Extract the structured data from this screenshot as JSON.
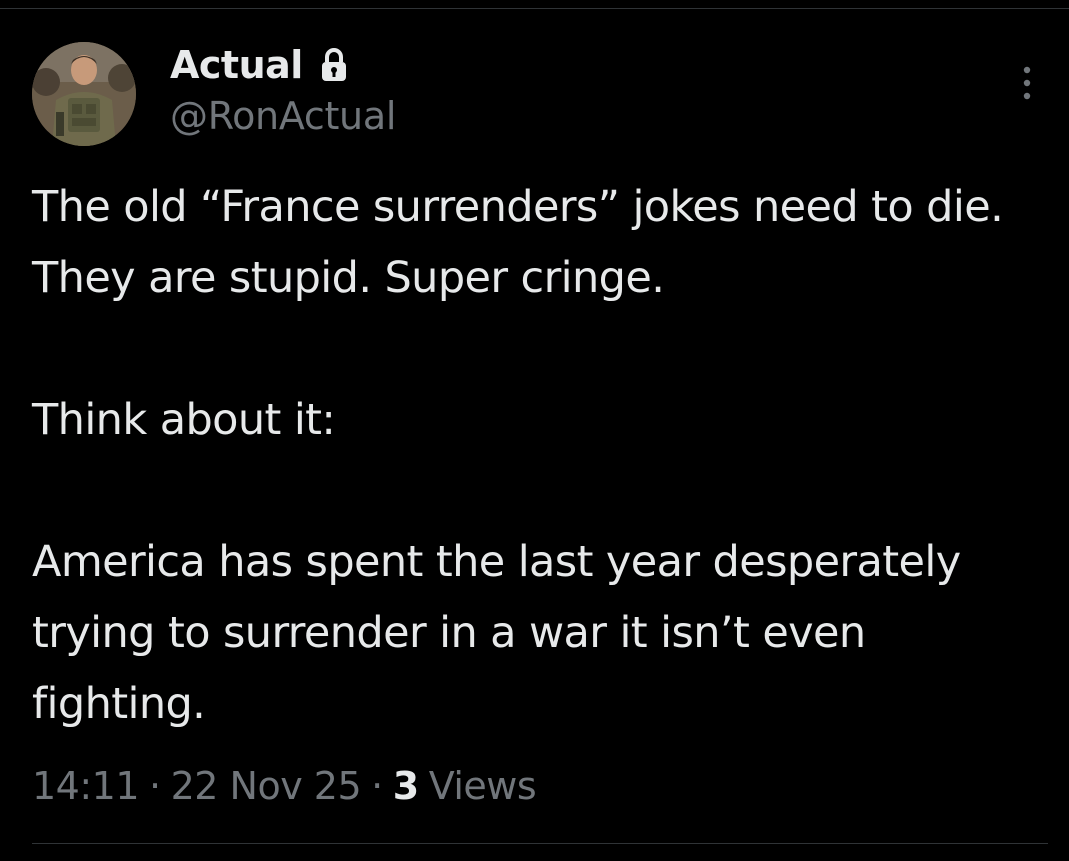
{
  "author": {
    "display_name": "Actual",
    "handle": "@RonActual",
    "verified_lock": "lock-icon",
    "avatar": "avatar-soldier-photo"
  },
  "tweet": {
    "paragraphs": [
      "The old “France surrenders” jokes need to die. They are stupid. Super cringe.",
      "Think about it:",
      "America has spent the last year desperately trying to surrender in a war it isn’t even fighting."
    ]
  },
  "meta": {
    "time": "14:11",
    "separator": "·",
    "date": "22 Nov 25",
    "views_count": "3",
    "views_label": "Views"
  },
  "colors": {
    "background": "#000000",
    "text_primary": "#e7e9ea",
    "text_secondary": "#71767b",
    "divider": "#2f3336"
  }
}
